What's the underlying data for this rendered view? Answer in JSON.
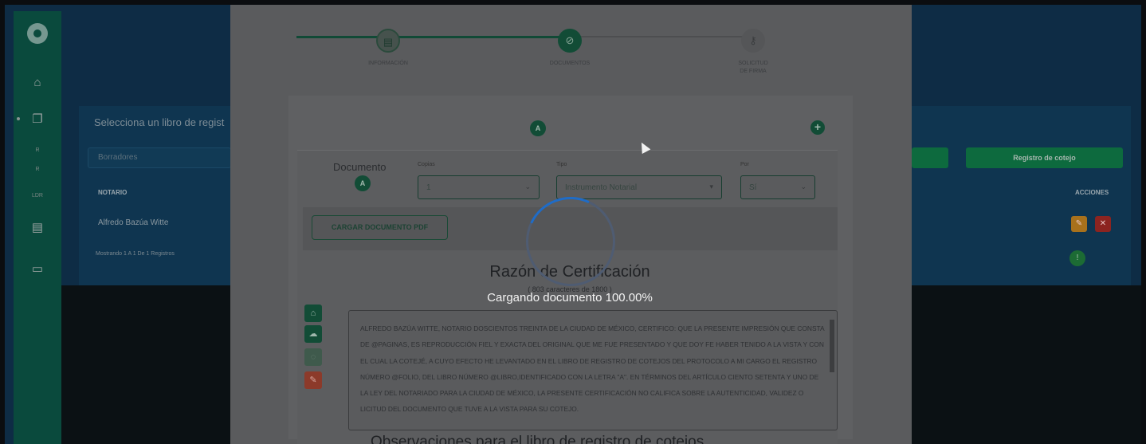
{
  "sidebar": {
    "labels": [
      "R",
      "R",
      "LDR"
    ]
  },
  "background": {
    "title": "Selecciona un libro de regist",
    "select_value": "Borradores",
    "table_headers": {
      "notario": "NOTARIO",
      "acciones": "ACCIONES"
    },
    "row": {
      "notario": "Alfredo Bazúa Witte"
    },
    "footer": "Mostrando 1 A 1 De 1 Registros",
    "register_button": "Registro de cotejo"
  },
  "steps": [
    {
      "label": "INFORMACIÓN",
      "icon": "document-icon"
    },
    {
      "label": "DOCUMENTOS",
      "icon": "paperclip-icon"
    },
    {
      "label": "SOLICITUD\nDE FIRMA",
      "icon": "key-icon"
    }
  ],
  "document": {
    "avatar_letter": "A",
    "label": "Documento",
    "copias_label": "Copias",
    "copias_value": "1",
    "tipo_label": "Tipo",
    "tipo_value": "Instrumento Notarial",
    "por_label": "Por",
    "por_value": "Sí",
    "upload_button": "CARGAR DOCUMENTO PDF"
  },
  "certification": {
    "title": "Razón de Certificación",
    "char_count": "( 803 caracteres de 1800 )",
    "loading_text": "Cargando documento 100.00%",
    "text": "ALFREDO BAZÚA WITTE, NOTARIO DOSCIENTOS TREINTA DE LA CIUDAD DE MÉXICO, CERTIFICO: QUE LA PRESENTE IMPRESIÓN QUE CONSTA DE @PAGINAS, ES REPRODUCCIÓN FIEL Y EXACTA DEL ORIGINAL QUE ME FUE PRESENTADO Y QUE DOY FE HABER TENIDO A LA VISTA Y CON EL CUAL LA COTEJÉ, A CUYO EFECTO HE LEVANTADO EN EL LIBRO DE REGISTRO DE COTEJOS DEL PROTOCOLO A MI CARGO EL REGISTRO NÚMERO @FOLIO, DEL LIBRO NÚMERO @LIBRO,IDENTIFICADO CON LA LETRA \"A\". EN TÉRMINOS DEL ARTÍCULO CIENTO SETENTA Y UNO DE LA LEY DEL NOTARIADO PARA LA CIUDAD DE MÉXICO, LA PRESENTE CERTIFICACIÓN NO CALIFICA SOBRE LA AUTENTICIDAD, VALIDEZ O LICITUD DEL DOCUMENTO QUE TUVE A LA VISTA PARA SU COTEJO.",
    "bottom_heading": "Observaciones para el libro de registro de cotejos"
  },
  "colors": {
    "accent_green": "#124c36",
    "step_line": "#114a36",
    "spinner": "#1f6cc7",
    "danger": "#c53a2a"
  }
}
